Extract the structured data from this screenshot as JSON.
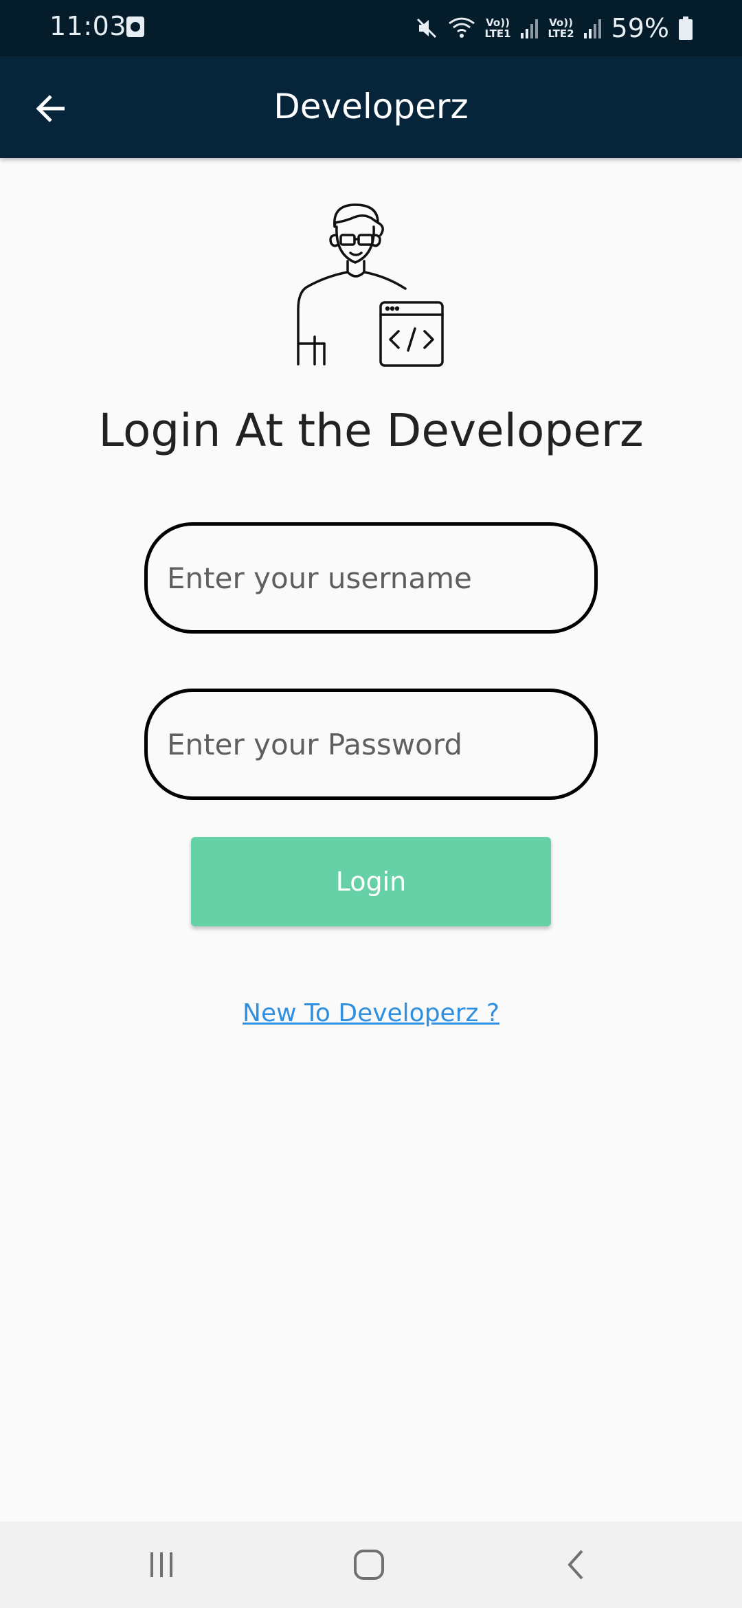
{
  "status_bar": {
    "time": "11:03",
    "lte1": "Vo))\nLTE1",
    "lte2": "Vo))\nLTE2",
    "battery": "59%",
    "icons": [
      "mute-icon",
      "wifi-icon",
      "signal-icon",
      "battery-icon"
    ]
  },
  "app_bar": {
    "title": "Developerz",
    "back_icon": "arrow-left-icon"
  },
  "login": {
    "heading": "Login At the Developerz",
    "username_placeholder": "Enter your username",
    "password_placeholder": "Enter your Password",
    "login_label": "Login",
    "signup_link": "New To Developerz ?"
  },
  "nav_bar": {
    "icons": [
      "recent-apps-icon",
      "home-icon",
      "back-icon"
    ]
  },
  "colors": {
    "status_bar": "#051c2b",
    "app_bar": "#06243a",
    "login_button": "#66d1a7",
    "link": "#2f8fe0"
  }
}
